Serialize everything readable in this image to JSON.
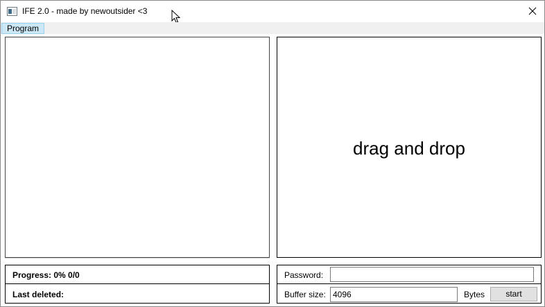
{
  "window": {
    "title": "IFE 2.0 - made by newoutsider <3",
    "app_icon": "window-app-icon",
    "close_icon": "close-icon"
  },
  "menu": {
    "items": [
      {
        "label": "Program"
      }
    ]
  },
  "drop_area": {
    "text": "drag and drop"
  },
  "status": {
    "progress": "Progress: 0% 0/0",
    "last_deleted": "Last deleted:"
  },
  "options": {
    "password_label": "Password:",
    "password_value": "",
    "buffer_label": "Buffer size:",
    "buffer_value": "4096",
    "bytes_label": "Bytes",
    "start_label": "start"
  },
  "colors": {
    "menu_highlight": "#cce8f6",
    "menu_highlight_border": "#99d1ef",
    "menubar_bg": "#f0f0f0",
    "button_bg": "#e1e1e1"
  }
}
